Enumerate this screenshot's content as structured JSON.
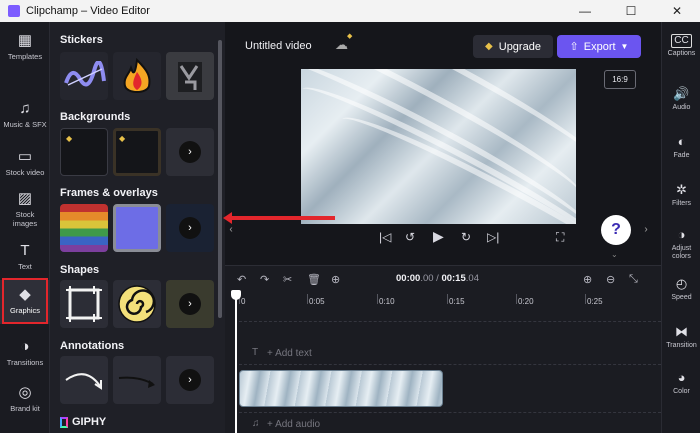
{
  "window": {
    "title": "Clipchamp – Video Editor",
    "minimize": "—",
    "maximize": "☐",
    "close": "✕"
  },
  "left_nav": [
    {
      "label": "Templates",
      "icon": "templates-icon",
      "glyph": "▦"
    },
    {
      "label": "Music & SFX",
      "icon": "music-icon",
      "glyph": "♫"
    },
    {
      "label": "Stock video",
      "icon": "stock-video-icon",
      "glyph": "▭"
    },
    {
      "label": "Stock images",
      "icon": "stock-images-icon",
      "glyph": "▨"
    },
    {
      "label": "Text",
      "icon": "text-icon",
      "glyph": "T"
    },
    {
      "label": "Graphics",
      "icon": "graphics-icon",
      "glyph": "◆"
    },
    {
      "label": "Transitions",
      "icon": "transitions-icon",
      "glyph": "◑"
    },
    {
      "label": "Brand kit",
      "icon": "brand-kit-icon",
      "glyph": "◎"
    }
  ],
  "panel": {
    "sections": [
      {
        "title": "Stickers"
      },
      {
        "title": "Backgrounds"
      },
      {
        "title": "Frames & overlays"
      },
      {
        "title": "Shapes"
      },
      {
        "title": "Annotations"
      }
    ],
    "giphy": "GIPHY",
    "more_glyph": "›"
  },
  "editor": {
    "project_name": "Untitled video",
    "upgrade_label": "Upgrade",
    "export_label": "Export",
    "aspect_ratio": "16:9",
    "help_glyph": "?",
    "time_current": "00:00",
    "time_current_ms": ".00",
    "time_total": "00:15",
    "time_total_ms": ".04",
    "ruler_labels": [
      "0",
      "0:05",
      "0:10",
      "0:15",
      "0:20",
      "0:25"
    ],
    "add_text": "+ Add text",
    "add_audio": "+ Add audio"
  },
  "right_nav": [
    {
      "label": "Captions",
      "icon": "captions-icon",
      "glyph": "CC"
    },
    {
      "label": "Audio",
      "icon": "audio-icon",
      "glyph": "🔊"
    },
    {
      "label": "Fade",
      "icon": "fade-icon",
      "glyph": "◐"
    },
    {
      "label": "Filters",
      "icon": "filters-icon",
      "glyph": "✲"
    },
    {
      "label": "Adjust colors",
      "icon": "adjust-colors-icon",
      "glyph": "◑"
    },
    {
      "label": "Speed",
      "icon": "speed-icon",
      "glyph": "◴"
    },
    {
      "label": "Transition",
      "icon": "transition-icon",
      "glyph": "⧓"
    },
    {
      "label": "Color",
      "icon": "color-icon",
      "glyph": "◕"
    }
  ],
  "colors": {
    "accent": "#6b55f0",
    "highlight": "#e3262c",
    "background": "#15161b"
  }
}
